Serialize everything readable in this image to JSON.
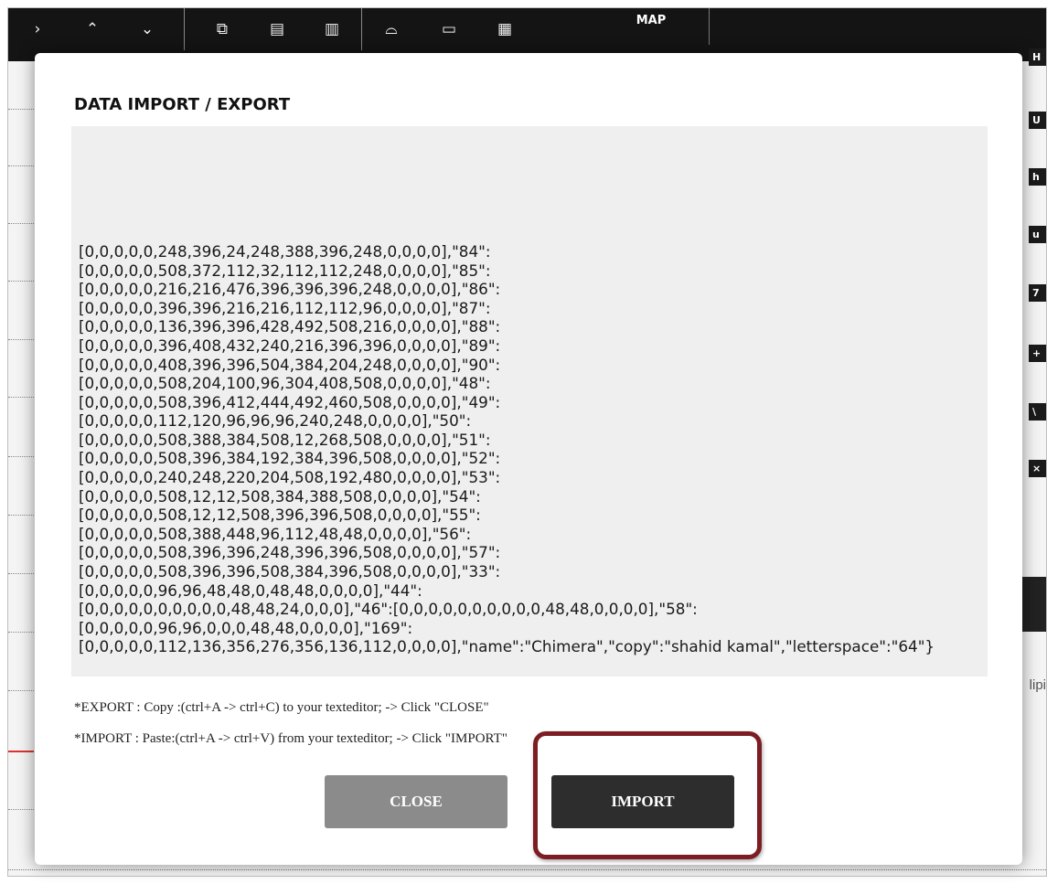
{
  "toolbar": {
    "items": [
      {
        "icon": "chevron-right-icon",
        "glyph": "›"
      },
      {
        "icon": "chevron-up-icon",
        "glyph": "⌃"
      },
      {
        "icon": "chevron-down-icon",
        "glyph": "⌄"
      },
      {
        "icon": "copy-layer-icon",
        "glyph": "⧉"
      },
      {
        "icon": "paste-layer-icon",
        "glyph": "▤"
      },
      {
        "icon": "grid-icon",
        "glyph": "▥"
      },
      {
        "icon": "open-folder-icon",
        "glyph": "⌓"
      },
      {
        "icon": "window-icon",
        "glyph": "▭"
      },
      {
        "icon": "export-icon",
        "glyph": "▦"
      }
    ],
    "map_label": "MAP"
  },
  "sidebar_keys": [
    "H",
    "U",
    "h",
    "u",
    "7",
    "+",
    "\\",
    "×"
  ],
  "sidebar_text": "lipi",
  "modal": {
    "title": "DATA IMPORT / EXPORT",
    "textarea_value": "[0,0,0,0,0,248,396,24,248,388,396,248,0,0,0,0],\"84\":\n[0,0,0,0,0,508,372,112,32,112,112,248,0,0,0,0],\"85\":\n[0,0,0,0,0,216,216,476,396,396,396,248,0,0,0,0],\"86\":\n[0,0,0,0,0,396,396,216,216,112,112,96,0,0,0,0],\"87\":\n[0,0,0,0,0,136,396,396,428,492,508,216,0,0,0,0],\"88\":\n[0,0,0,0,0,396,408,432,240,216,396,396,0,0,0,0],\"89\":\n[0,0,0,0,0,408,396,396,504,384,204,248,0,0,0,0],\"90\":\n[0,0,0,0,0,508,204,100,96,304,408,508,0,0,0,0],\"48\":\n[0,0,0,0,0,508,396,412,444,492,460,508,0,0,0,0],\"49\":\n[0,0,0,0,0,112,120,96,96,96,240,248,0,0,0,0],\"50\":\n[0,0,0,0,0,508,388,384,508,12,268,508,0,0,0,0],\"51\":\n[0,0,0,0,0,508,396,384,192,384,396,508,0,0,0,0],\"52\":\n[0,0,0,0,0,240,248,220,204,508,192,480,0,0,0,0],\"53\":\n[0,0,0,0,0,508,12,12,508,384,388,508,0,0,0,0],\"54\":\n[0,0,0,0,0,508,12,12,508,396,396,508,0,0,0,0],\"55\":\n[0,0,0,0,0,508,388,448,96,112,48,48,0,0,0,0],\"56\":\n[0,0,0,0,0,508,396,396,248,396,396,508,0,0,0,0],\"57\":\n[0,0,0,0,0,508,396,396,508,384,396,508,0,0,0,0],\"33\":\n[0,0,0,0,0,96,96,48,48,0,48,48,0,0,0,0],\"44\":\n[0,0,0,0,0,0,0,0,0,0,48,48,24,0,0,0],\"46\":[0,0,0,0,0,0,0,0,0,0,48,48,0,0,0,0],\"58\":\n[0,0,0,0,0,96,96,0,0,0,48,48,0,0,0,0],\"169\":\n[0,0,0,0,0,112,136,356,276,356,136,112,0,0,0,0],\"name\":\"Chimera\",\"copy\":\"shahid kamal\",\"letterspace\":\"64\"}",
    "export_note": "*EXPORT : Copy :(ctrl+A -> ctrl+C) to your texteditor; -> Click \"CLOSE\"",
    "import_note": "*IMPORT : Paste:(ctrl+A -> ctrl+V) from your texteditor; -> Click \"IMPORT\"",
    "close_label": "CLOSE",
    "import_label": "IMPORT"
  },
  "colors": {
    "highlight_ring": "#7c1d23",
    "close_button": "#8b8b8b",
    "import_button": "#2d2d2d",
    "toolbar": "#141414"
  }
}
